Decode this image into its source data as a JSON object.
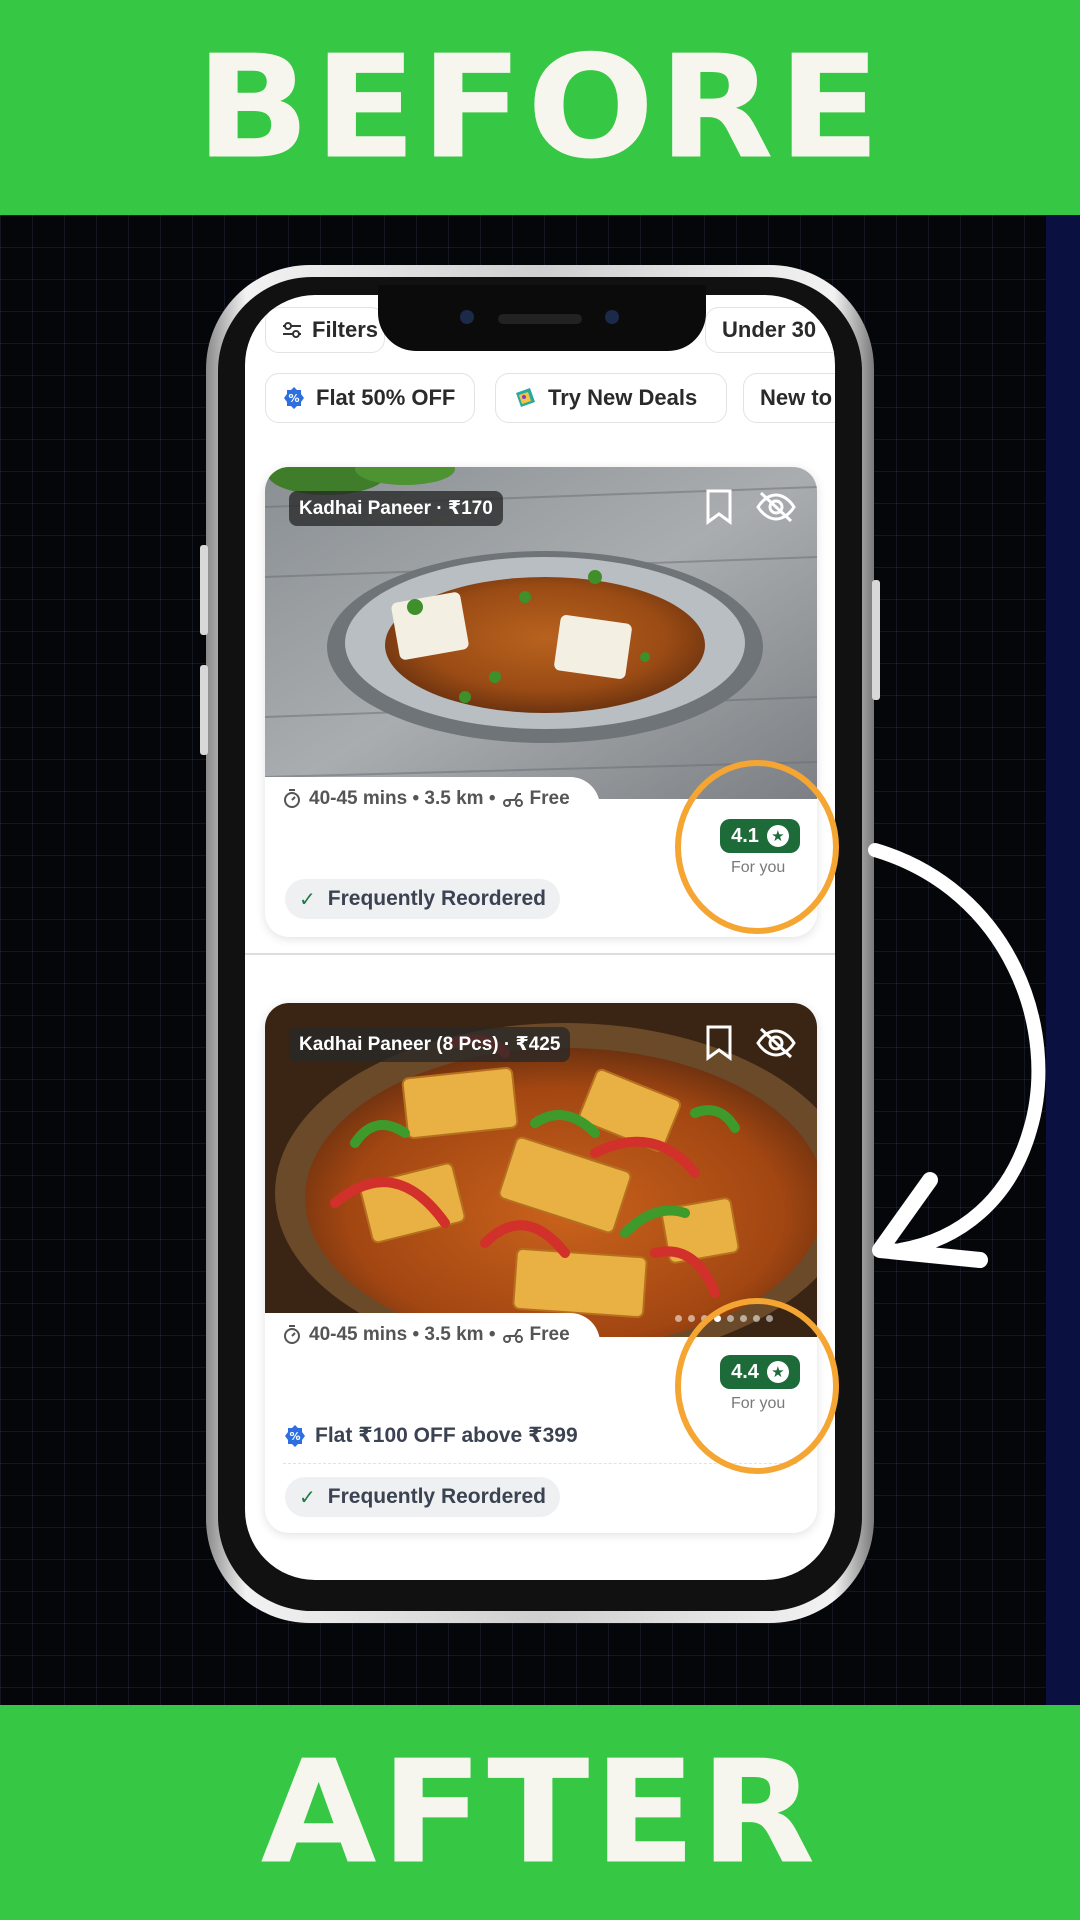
{
  "banner_top": "BEFORE",
  "banner_bottom": "AFTER",
  "filter_chips": {
    "filters": "Filters",
    "under": "Under 30",
    "flat_off": "Flat 50% OFF",
    "try_deals": "Try New Deals",
    "new_to": "New to"
  },
  "cards": [
    {
      "dish_tag": "Kadhai Paneer · ₹170",
      "meta": "40-45 mins • 3.5 km • ",
      "delivery": "Free",
      "rating": "4.1",
      "rating_caption": "For you",
      "reorder_label": "Frequently Reordered"
    },
    {
      "dish_tag": "Kadhai Paneer (8 Pcs) · ₹425",
      "meta": "40-45 mins • 3.5 km • ",
      "delivery": "Free",
      "rating": "4.4",
      "rating_caption": "For you",
      "offer": "Flat ₹100 OFF above ₹399",
      "reorder_label": "Frequently Reordered"
    }
  ],
  "colors": {
    "banner": "#36c744",
    "rating_badge": "#1e6b3a",
    "highlight_ring": "#f5a532"
  },
  "icons": [
    "filter-icon",
    "discount-icon",
    "deals-icon",
    "bookmark-icon",
    "hide-icon",
    "timer-icon",
    "scooter-icon",
    "check-icon",
    "star-icon",
    "curved-arrow-icon"
  ]
}
